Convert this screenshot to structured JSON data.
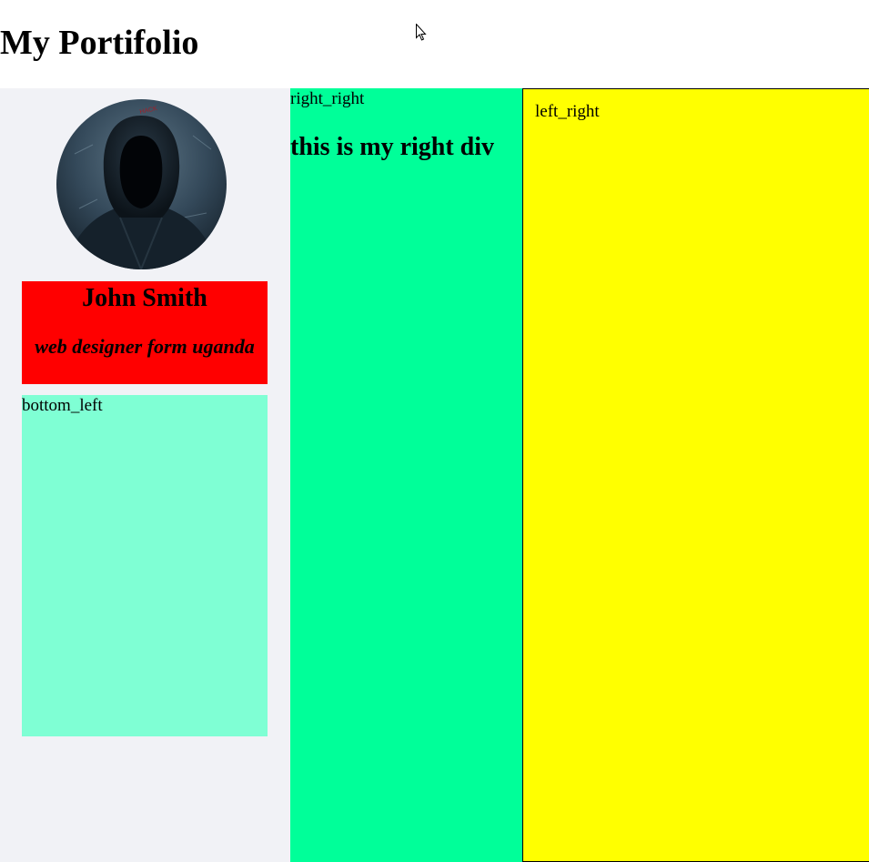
{
  "header": {
    "title": "My Portifolio"
  },
  "profile": {
    "avatar_icon": "hooded-figure-photo",
    "name": "John Smith",
    "role": "web designer form uganda"
  },
  "boxes": {
    "bottom_left_label": "bottom_left",
    "right_right_label": "right_right",
    "right_right_heading": "this is my right div",
    "left_right_label": "left_right"
  },
  "colors": {
    "name_card": "#ff0000",
    "bottom_left": "#7fffd4",
    "right_right": "#00ff99",
    "left_right": "#ffff00",
    "left_column": "#f1f2f6"
  }
}
